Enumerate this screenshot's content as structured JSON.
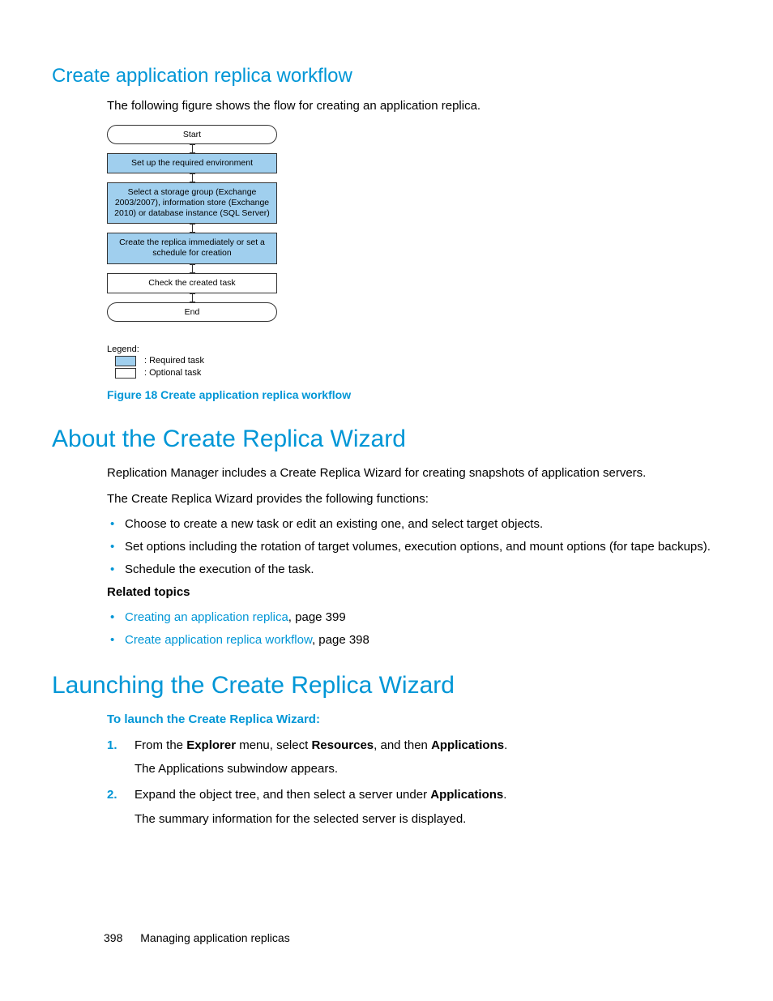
{
  "section1": {
    "heading": "Create application replica workflow",
    "intro": "The following figure shows the flow for creating an application replica."
  },
  "flowchart": {
    "start": "Start",
    "step1": "Set up the required environment",
    "step2": "Select a storage group (Exchange 2003/2007), information store (Exchange 2010) or database instance (SQL Server)",
    "step3": "Create the replica immediately or set a schedule for creation",
    "step4": "Check the created task",
    "end": "End"
  },
  "legend": {
    "title": "Legend:",
    "required": ": Required task",
    "optional": ": Optional task"
  },
  "figure_caption": "Figure 18 Create application replica workflow",
  "section2": {
    "heading": "About the Create Replica Wizard",
    "p1": "Replication Manager includes a Create Replica Wizard for creating snapshots of application servers.",
    "p2": "The Create Replica Wizard provides the following functions:",
    "bullets": [
      "Choose to create a new task or edit an existing one, and select target objects.",
      "Set options including the rotation of target volumes, execution options, and mount options (for tape backups).",
      "Schedule the execution of the task."
    ],
    "related_heading": "Related topics",
    "related": [
      {
        "link": "Creating an application replica",
        "suffix": ", page 399"
      },
      {
        "link": "Create application replica workflow",
        "suffix": ", page 398"
      }
    ]
  },
  "section3": {
    "heading": "Launching the Create Replica Wizard",
    "sub": "To launch the Create Replica Wizard:",
    "steps": [
      {
        "num": "1.",
        "pre": "From the ",
        "b1": "Explorer",
        "mid1": " menu, select ",
        "b2": "Resources",
        "mid2": ", and then ",
        "b3": "Applications",
        "post": ".",
        "result": "The Applications subwindow appears."
      },
      {
        "num": "2.",
        "pre": "Expand the object tree, and then select a server under ",
        "b1": "Applications",
        "mid1": "",
        "b2": "",
        "mid2": "",
        "b3": "",
        "post": ".",
        "result": "The summary information for the selected server is displayed."
      }
    ]
  },
  "footer": {
    "page": "398",
    "title": "Managing application replicas"
  }
}
